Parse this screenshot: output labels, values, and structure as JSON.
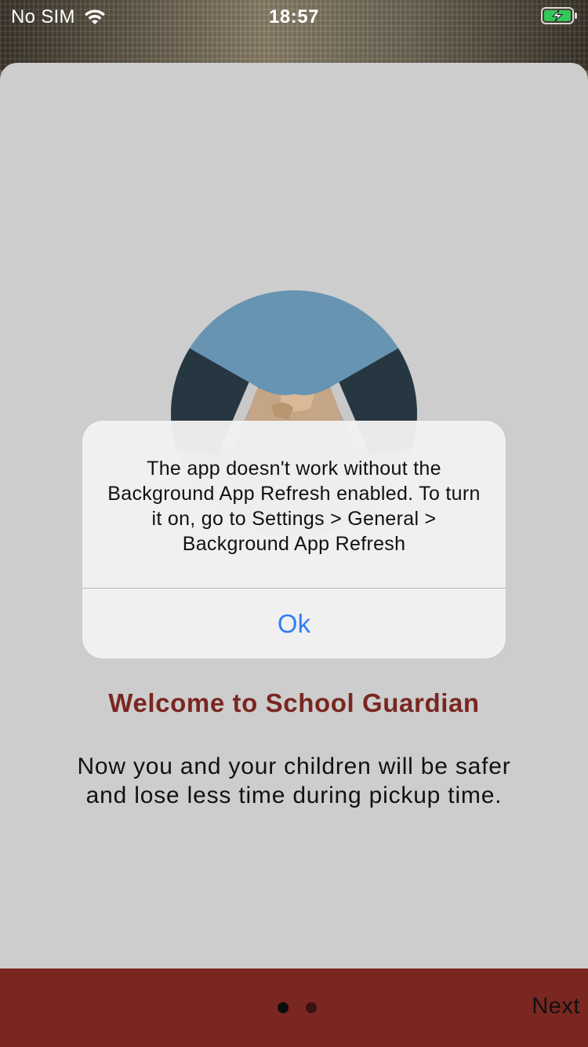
{
  "status_bar": {
    "carrier": "No SIM",
    "time": "18:57",
    "wifi_icon": "wifi-icon",
    "battery_icon": "battery-charging-icon",
    "battery_color": "#34c759"
  },
  "onboarding": {
    "illustration": "handshake-illustration",
    "title": "Welcome to School Guardian",
    "body": "Now you and your children will be safer and lose less time during pickup time.",
    "title_color": "#7a2621"
  },
  "bottom_bar": {
    "background": "#7a2621",
    "page_count": 2,
    "current_page": 1,
    "next_label": "Next"
  },
  "alert": {
    "message": "The app doesn't work without the Background App Refresh enabled. To turn it on, go to Settings > General > Background App Refresh",
    "ok_label": "Ok",
    "accent": "#2f7ef5"
  }
}
